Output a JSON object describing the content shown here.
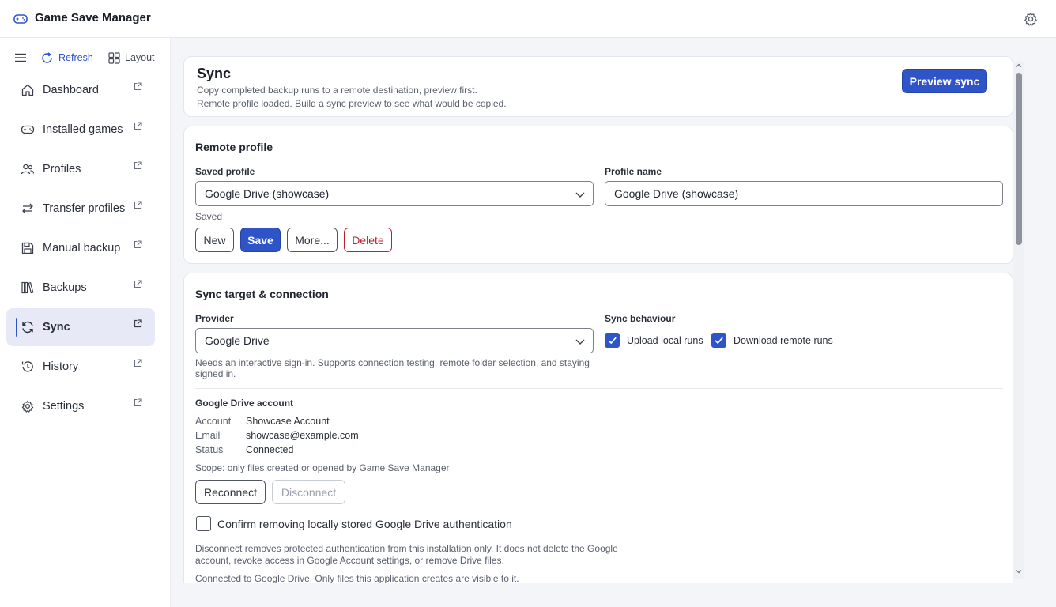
{
  "app": {
    "title": "Game Save Manager",
    "settings_icon": "gear-icon"
  },
  "sidebar": {
    "refresh_label": "Refresh",
    "layout_label": "Layout",
    "items": [
      {
        "label": "Dashboard",
        "icon": "home-icon"
      },
      {
        "label": "Installed games",
        "icon": "gamepad-icon"
      },
      {
        "label": "Profiles",
        "icon": "users-icon"
      },
      {
        "label": "Transfer profiles",
        "icon": "transfer-icon"
      },
      {
        "label": "Manual backup",
        "icon": "save-icon"
      },
      {
        "label": "Backups",
        "icon": "library-icon"
      },
      {
        "label": "Sync",
        "icon": "sync-icon",
        "active": true
      },
      {
        "label": "History",
        "icon": "history-icon"
      },
      {
        "label": "Settings",
        "icon": "gear-icon"
      }
    ]
  },
  "sync_header": {
    "title": "Sync",
    "subtitle": "Copy completed backup runs to a remote destination, preview first.",
    "status": "Remote profile loaded. Build a sync preview to see what would be copied.",
    "preview_button": "Preview sync"
  },
  "remote_profile": {
    "title": "Remote profile",
    "saved_profile_label": "Saved profile",
    "saved_profile_value": "Google Drive (showcase)",
    "profile_name_label": "Profile name",
    "profile_name_value": "Google Drive (showcase)",
    "saved_state": "Saved",
    "new_button": "New",
    "save_button": "Save",
    "more_button": "More...",
    "delete_button": "Delete"
  },
  "sync_target": {
    "title": "Sync target & connection",
    "provider_label": "Provider",
    "provider_value": "Google Drive",
    "provider_help": "Needs an interactive sign-in. Supports connection testing, remote folder selection, and staying signed in.",
    "behaviour_label": "Sync behaviour",
    "upload_label": "Upload local runs",
    "upload_checked": true,
    "download_label": "Download remote runs",
    "download_checked": true,
    "account_title": "Google Drive account",
    "account_key": "Account",
    "account_value": "Showcase Account",
    "email_key": "Email",
    "email_value": "showcase@example.com",
    "status_key": "Status",
    "status_value": "Connected",
    "scope_text": "Scope: only files created or opened by Game Save Manager",
    "reconnect_button": "Reconnect",
    "disconnect_button": "Disconnect",
    "confirm_label": "Confirm removing locally stored Google Drive authentication",
    "confirm_checked": false,
    "disconnect_note": "Disconnect removes protected authentication from this installation only. It does not delete the Google account, revoke access in Google Account settings, or remove Drive files.",
    "connected_note": "Connected to Google Drive. Only files this application creates are visible to it."
  },
  "colors": {
    "accent": "#2f54c8",
    "danger": "#b5232d"
  }
}
